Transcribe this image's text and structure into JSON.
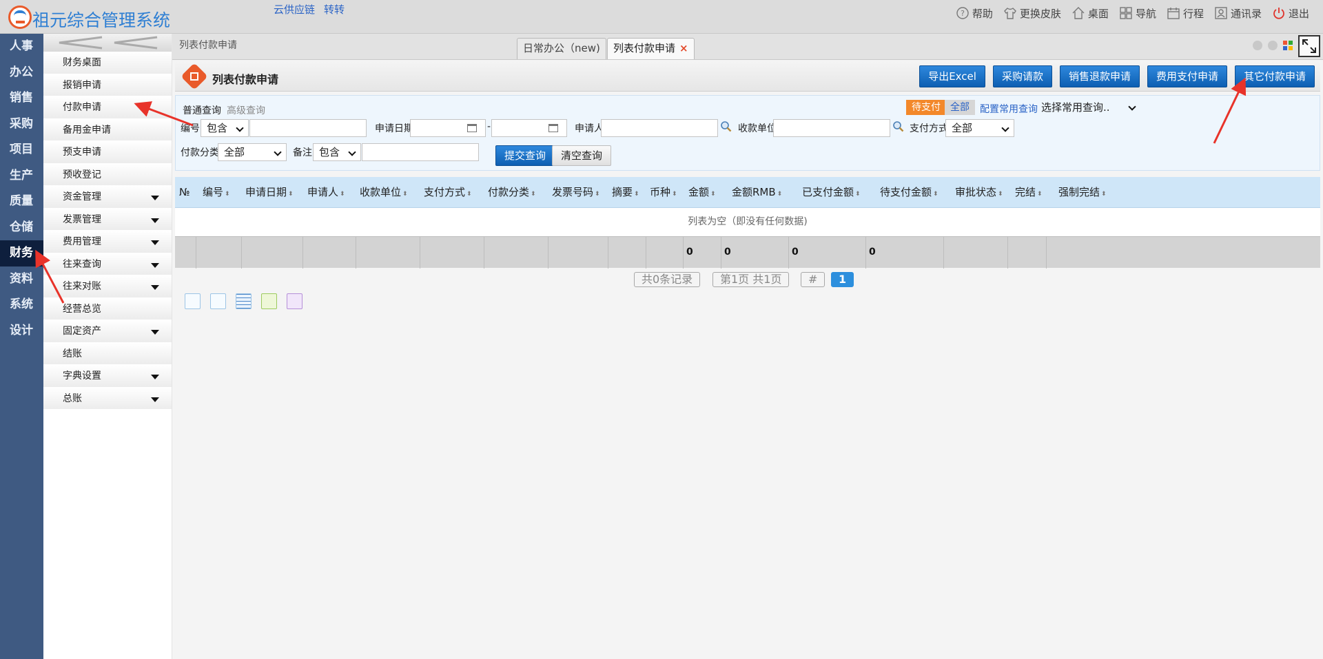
{
  "app": {
    "title": "祖元综合管理系统",
    "top_links": [
      "云供应链",
      "转转"
    ],
    "tools": [
      {
        "label": "帮助",
        "icon": "help-icon"
      },
      {
        "label": "更换皮肤",
        "icon": "shirt-icon"
      },
      {
        "label": "桌面",
        "icon": "home-icon"
      },
      {
        "label": "导航",
        "icon": "grid-icon"
      },
      {
        "label": "行程",
        "icon": "calendar-icon"
      },
      {
        "label": "通讯录",
        "icon": "contacts-icon"
      },
      {
        "label": "退出",
        "icon": "power-icon"
      }
    ]
  },
  "leftnav": {
    "items": [
      "人事",
      "办公",
      "销售",
      "采购",
      "项目",
      "生产",
      "质量",
      "仓储",
      "财务",
      "资料",
      "系统",
      "设计"
    ],
    "active": "财务"
  },
  "submenu": {
    "items": [
      {
        "label": "财务桌面",
        "has_children": false
      },
      {
        "label": "报销申请",
        "has_children": false
      },
      {
        "label": "付款申请",
        "has_children": false
      },
      {
        "label": "备用金申请",
        "has_children": false
      },
      {
        "label": "预支申请",
        "has_children": false
      },
      {
        "label": "预收登记",
        "has_children": false
      },
      {
        "label": "资金管理",
        "has_children": true
      },
      {
        "label": "发票管理",
        "has_children": true
      },
      {
        "label": "费用管理",
        "has_children": true
      },
      {
        "label": "往来查询",
        "has_children": true
      },
      {
        "label": "往来对账",
        "has_children": true
      },
      {
        "label": "经营总览",
        "has_children": false
      },
      {
        "label": "固定资产",
        "has_children": true
      },
      {
        "label": "结账",
        "has_children": false
      },
      {
        "label": "字典设置",
        "has_children": true
      },
      {
        "label": "总账",
        "has_children": true
      }
    ]
  },
  "tabs": {
    "breadcrumb": "列表付款申请",
    "items": [
      {
        "label": "日常办公（new)"
      },
      {
        "label": "列表付款申请",
        "closable": true
      }
    ],
    "close_glyph": "×"
  },
  "header": {
    "title": "列表付款申请",
    "buttons": [
      "导出Excel",
      "采购请款",
      "销售退款申请",
      "费用支付申请",
      "其它付款申请"
    ]
  },
  "query": {
    "tabs": [
      "普通查询",
      "高级查询"
    ],
    "state_filters": [
      "待支付",
      "全部"
    ],
    "config_link": "配置常用查询",
    "common_query": "选择常用查询..",
    "fields": {
      "number_label": "编号",
      "number_op": "包含",
      "date_label": "申请日期",
      "date_sep": "-",
      "applicant_label": "申请人",
      "payee_label": "收款单位",
      "paymethod_label": "支付方式",
      "paymethod_value": "全部",
      "category_label": "付款分类",
      "category_value": "全部",
      "remark_label": "备注",
      "remark_op": "包含"
    },
    "submit": "提交查询",
    "clear": "清空查询"
  },
  "grid": {
    "columns": [
      "№",
      "编号",
      "申请日期",
      "申请人",
      "收款单位",
      "支付方式",
      "付款分类",
      "发票号码",
      "摘要",
      "币种",
      "金额",
      "金额RMB",
      "已支付金额",
      "待支付金额",
      "审批状态",
      "完结",
      "强制完结"
    ],
    "sortable": "⬍",
    "empty_text": "列表为空（即没有任何数据)",
    "totals": [
      "0",
      "0",
      "0",
      "0"
    ]
  },
  "pager": {
    "records": "共0条记录",
    "pages": "第1页 共1页",
    "jump": "#",
    "current": "1"
  },
  "colors": {
    "nav_bg": "#3f5a82",
    "nav_active": "#0e1f3d",
    "primary_button": "#0d5fb2",
    "accent_orange": "#f3882a",
    "annotation_red": "#e8332a"
  }
}
